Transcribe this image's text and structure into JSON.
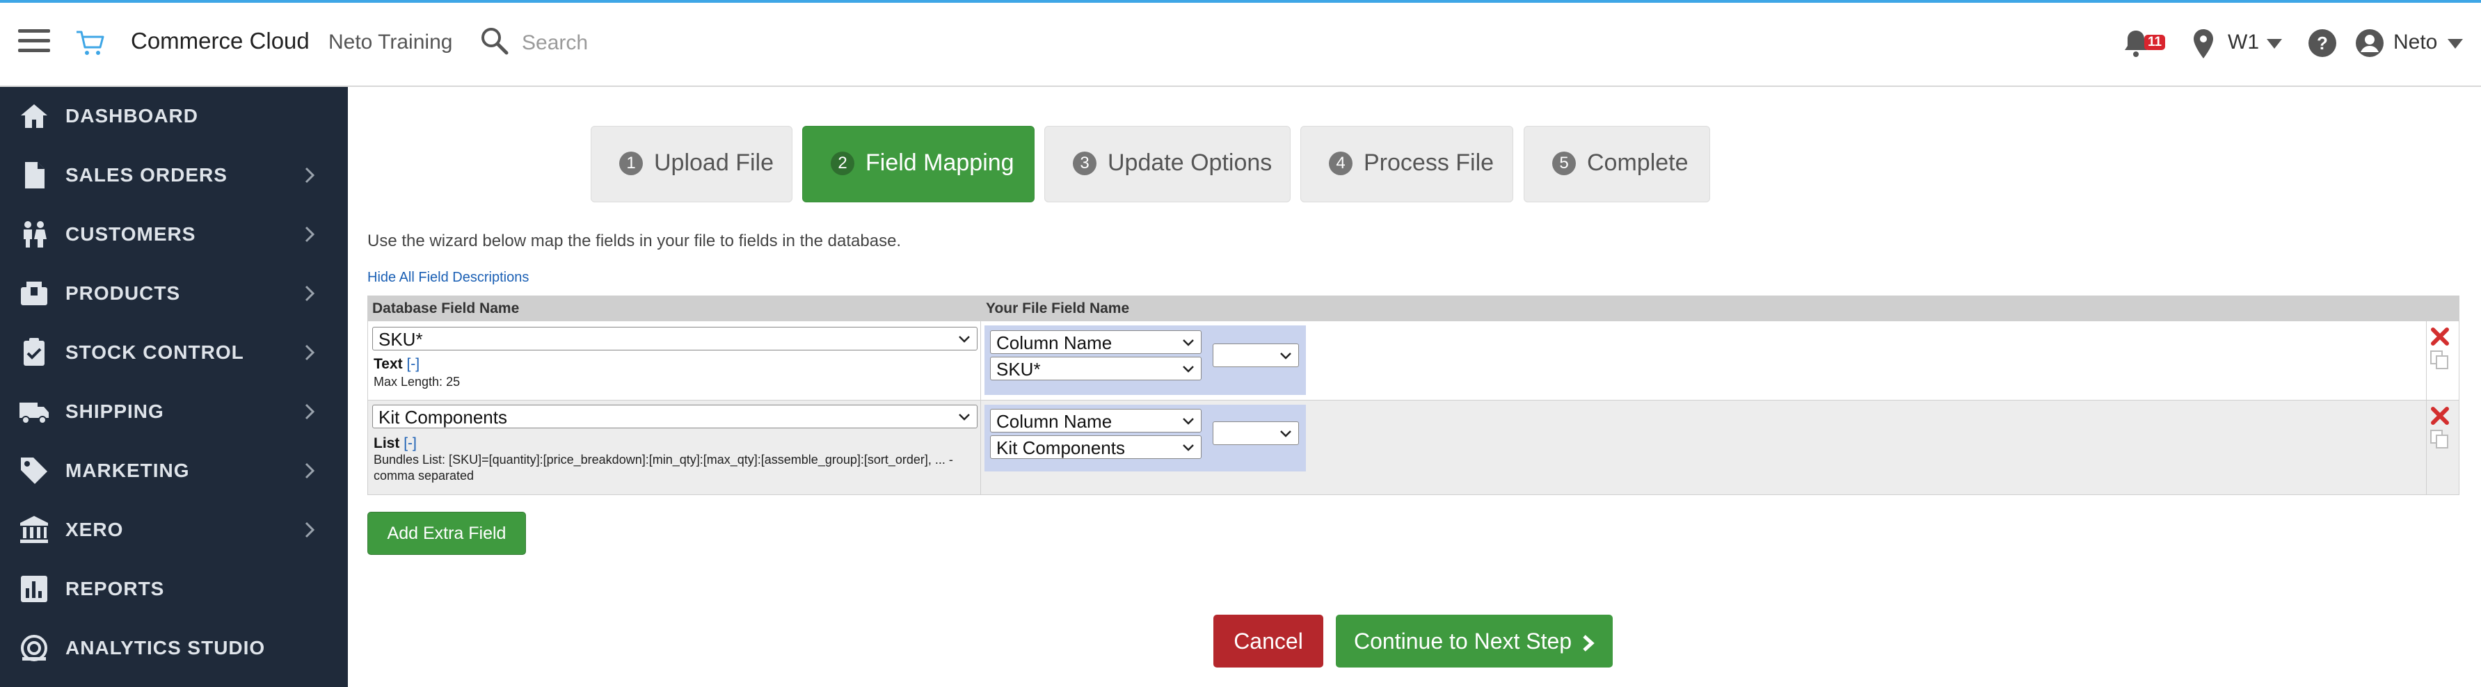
{
  "topbar": {
    "menu_icon": "hamburger-icon",
    "logo_icon": "cart-icon",
    "app_title": "Commerce Cloud",
    "account_name": "Neto Training",
    "search_placeholder": "Search",
    "notification_count": "11",
    "location": "W1",
    "user_name": "Neto",
    "accent_color": "#3ea6e6"
  },
  "sidebar": {
    "background": "#1f2a3a",
    "items": [
      {
        "label": "DASHBOARD",
        "icon": "home-icon",
        "has_children": false
      },
      {
        "label": "SALES ORDERS",
        "icon": "document-icon",
        "has_children": true
      },
      {
        "label": "CUSTOMERS",
        "icon": "people-icon",
        "has_children": true
      },
      {
        "label": "PRODUCTS",
        "icon": "box-icon",
        "has_children": true
      },
      {
        "label": "STOCK CONTROL",
        "icon": "clipboard-check-icon",
        "has_children": true
      },
      {
        "label": "SHIPPING",
        "icon": "truck-icon",
        "has_children": true
      },
      {
        "label": "MARKETING",
        "icon": "tag-icon",
        "has_children": true
      },
      {
        "label": "XERO",
        "icon": "bank-icon",
        "has_children": true
      },
      {
        "label": "REPORTS",
        "icon": "bar-chart-icon",
        "has_children": false
      },
      {
        "label": "ANALYTICS STUDIO",
        "icon": "analytics-icon",
        "has_children": false
      }
    ]
  },
  "wizard": {
    "steps": [
      {
        "num": "1",
        "label": "Upload File",
        "active": false
      },
      {
        "num": "2",
        "label": "Field Mapping",
        "active": true
      },
      {
        "num": "3",
        "label": "Update Options",
        "active": false
      },
      {
        "num": "4",
        "label": "Process File",
        "active": false
      },
      {
        "num": "5",
        "label": "Complete",
        "active": false
      }
    ],
    "intro": "Use the wizard below map the fields in your file to fields in the database.",
    "hide_descriptions": "Hide All Field Descriptions"
  },
  "mapping": {
    "col_db": "Database Field Name",
    "col_file": "Your File Field Name",
    "rows": [
      {
        "db_field": "SKU*",
        "type": "Text",
        "toggle": "[-]",
        "description": "Max Length: 25",
        "map_mode": "Column Name",
        "file_field": "SKU*",
        "extra": ""
      },
      {
        "db_field": "Kit Components",
        "type": "List",
        "toggle": "[-]",
        "description": "Bundles List: [SKU]=[quantity]:[price_breakdown]:[min_qty]:[max_qty]:[assemble_group]:[sort_order], ... - comma separated",
        "map_mode": "Column Name",
        "file_field": "Kit Components",
        "extra": ""
      }
    ]
  },
  "actions": {
    "add_field": "Add Extra Field",
    "cancel": "Cancel",
    "continue": "Continue to Next Step"
  },
  "colors": {
    "success": "#3f9a3f",
    "danger": "#b5272c"
  }
}
